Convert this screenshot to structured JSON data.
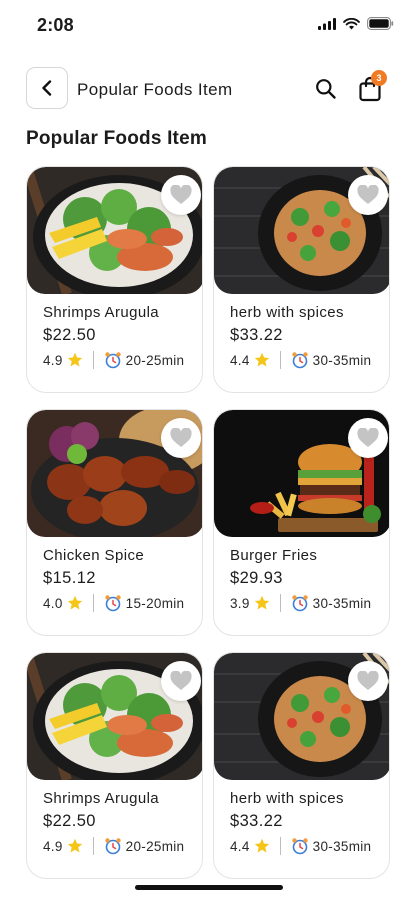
{
  "status": {
    "time": "2:08"
  },
  "header": {
    "title": "Popular Foods Item",
    "cart_count": "3",
    "icons": {
      "back": "chevron-left-icon",
      "search": "search-icon",
      "cart": "shopping-bag-icon"
    }
  },
  "section": {
    "title": "Popular Foods Item"
  },
  "colors": {
    "badge": "#f07b24",
    "star": "#f5c518",
    "heart": "#c4c4c4"
  },
  "foods": [
    {
      "name": "Shrimps Arugula",
      "price": "$22.50",
      "rating": "4.9",
      "time": "20-25min",
      "image": "shrimp-bowl"
    },
    {
      "name": "herb with spices",
      "price": "$33.22",
      "rating": "4.4",
      "time": "30-35min",
      "image": "noodle-plate"
    },
    {
      "name": "Chicken Spice",
      "price": "$15.12",
      "rating": "4.0",
      "time": "15-20min",
      "image": "chicken-plate"
    },
    {
      "name": "Burger Fries",
      "price": "$29.93",
      "rating": "3.9",
      "time": "30-35min",
      "image": "burger-fries"
    },
    {
      "name": "Shrimps Arugula",
      "price": "$22.50",
      "rating": "4.9",
      "time": "20-25min",
      "image": "shrimp-bowl"
    },
    {
      "name": "herb with spices",
      "price": "$33.22",
      "rating": "4.4",
      "time": "30-35min",
      "image": "noodle-plate"
    }
  ]
}
